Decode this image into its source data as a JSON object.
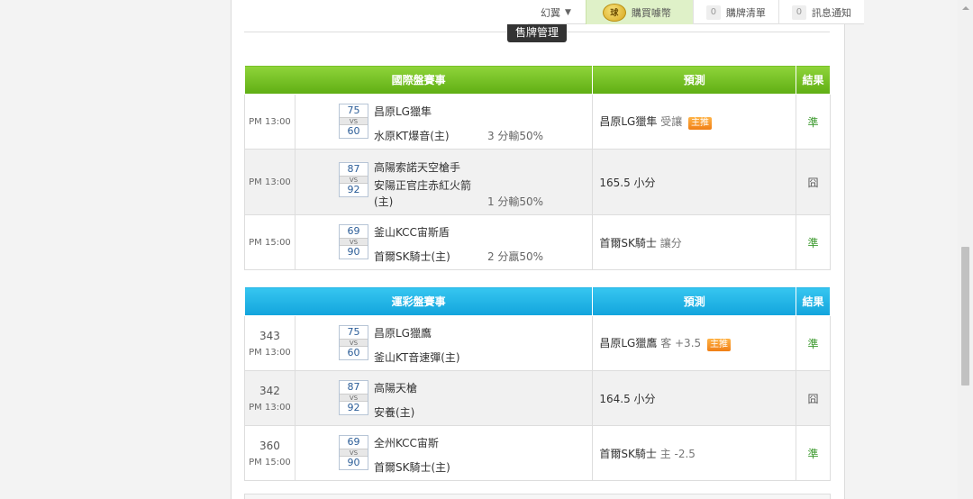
{
  "topbar": {
    "user_label": "幻翼",
    "coin_text": "球",
    "buy_label": "購買噱幣",
    "cart_count": "0",
    "cart_label": "購牌清單",
    "msg_count": "0",
    "msg_label": "訊息通知"
  },
  "section_title": "售牌管理",
  "international": {
    "headers": [
      "國際盤賽事",
      "預測",
      "結果"
    ],
    "rows": [
      {
        "time": "PM 13:00",
        "score1": "75",
        "score2": "60",
        "team1": "昌原LG獵隼",
        "team2": "水原KT爆音(主)",
        "handicap": "3 分輸50%",
        "pred_main": "昌原LG獵隼",
        "pred_sub": "受讓",
        "pred_tag": "主推",
        "result": "準"
      },
      {
        "time": "PM 13:00",
        "score1": "87",
        "score2": "92",
        "team1": "高陽索諾天空槍手",
        "team2": "安陽正官庄赤紅火箭",
        "team2b": "(主)",
        "handicap": "1 分輸50%",
        "pred_main": "165.5 小分",
        "result": "囧"
      },
      {
        "time": "PM 15:00",
        "score1": "69",
        "score2": "90",
        "team1": "釜山KCC宙斯盾",
        "team2": "首爾SK騎士(主)",
        "handicap": "2 分贏50%",
        "pred_main": "首爾SK騎士",
        "pred_sub": "讓分",
        "result": "準"
      }
    ]
  },
  "lottery": {
    "headers": [
      "運彩盤賽事",
      "預測",
      "結果"
    ],
    "rows": [
      {
        "num": "343",
        "time": "PM 13:00",
        "score1": "75",
        "score2": "60",
        "team1": "昌原LG獵鷹",
        "team2": "釜山KT音速彈(主)",
        "pred_main": "昌原LG獵鷹",
        "pred_sub": "客 +3.5",
        "pred_tag": "主推",
        "result": "準"
      },
      {
        "num": "342",
        "time": "PM 13:00",
        "score1": "87",
        "score2": "92",
        "team1": "高陽天槍",
        "team2": "安養(主)",
        "pred_main": "164.5 小分",
        "result": "囧"
      },
      {
        "num": "360",
        "time": "PM 15:00",
        "score1": "69",
        "score2": "90",
        "team1": "全州KCC宙斯",
        "team2": "首爾SK騎士(主)",
        "pred_main": "首爾SK騎士",
        "pred_sub": "主 -2.5",
        "result": "準"
      }
    ]
  },
  "colors": {
    "green_header": "#6cbf1f",
    "blue_header": "#1aaee3",
    "tag_orange": "#f28a1c",
    "hit_green": "#3d9a2f"
  },
  "icons": {
    "caret": "caret-down-icon",
    "coin": "coin-icon"
  }
}
